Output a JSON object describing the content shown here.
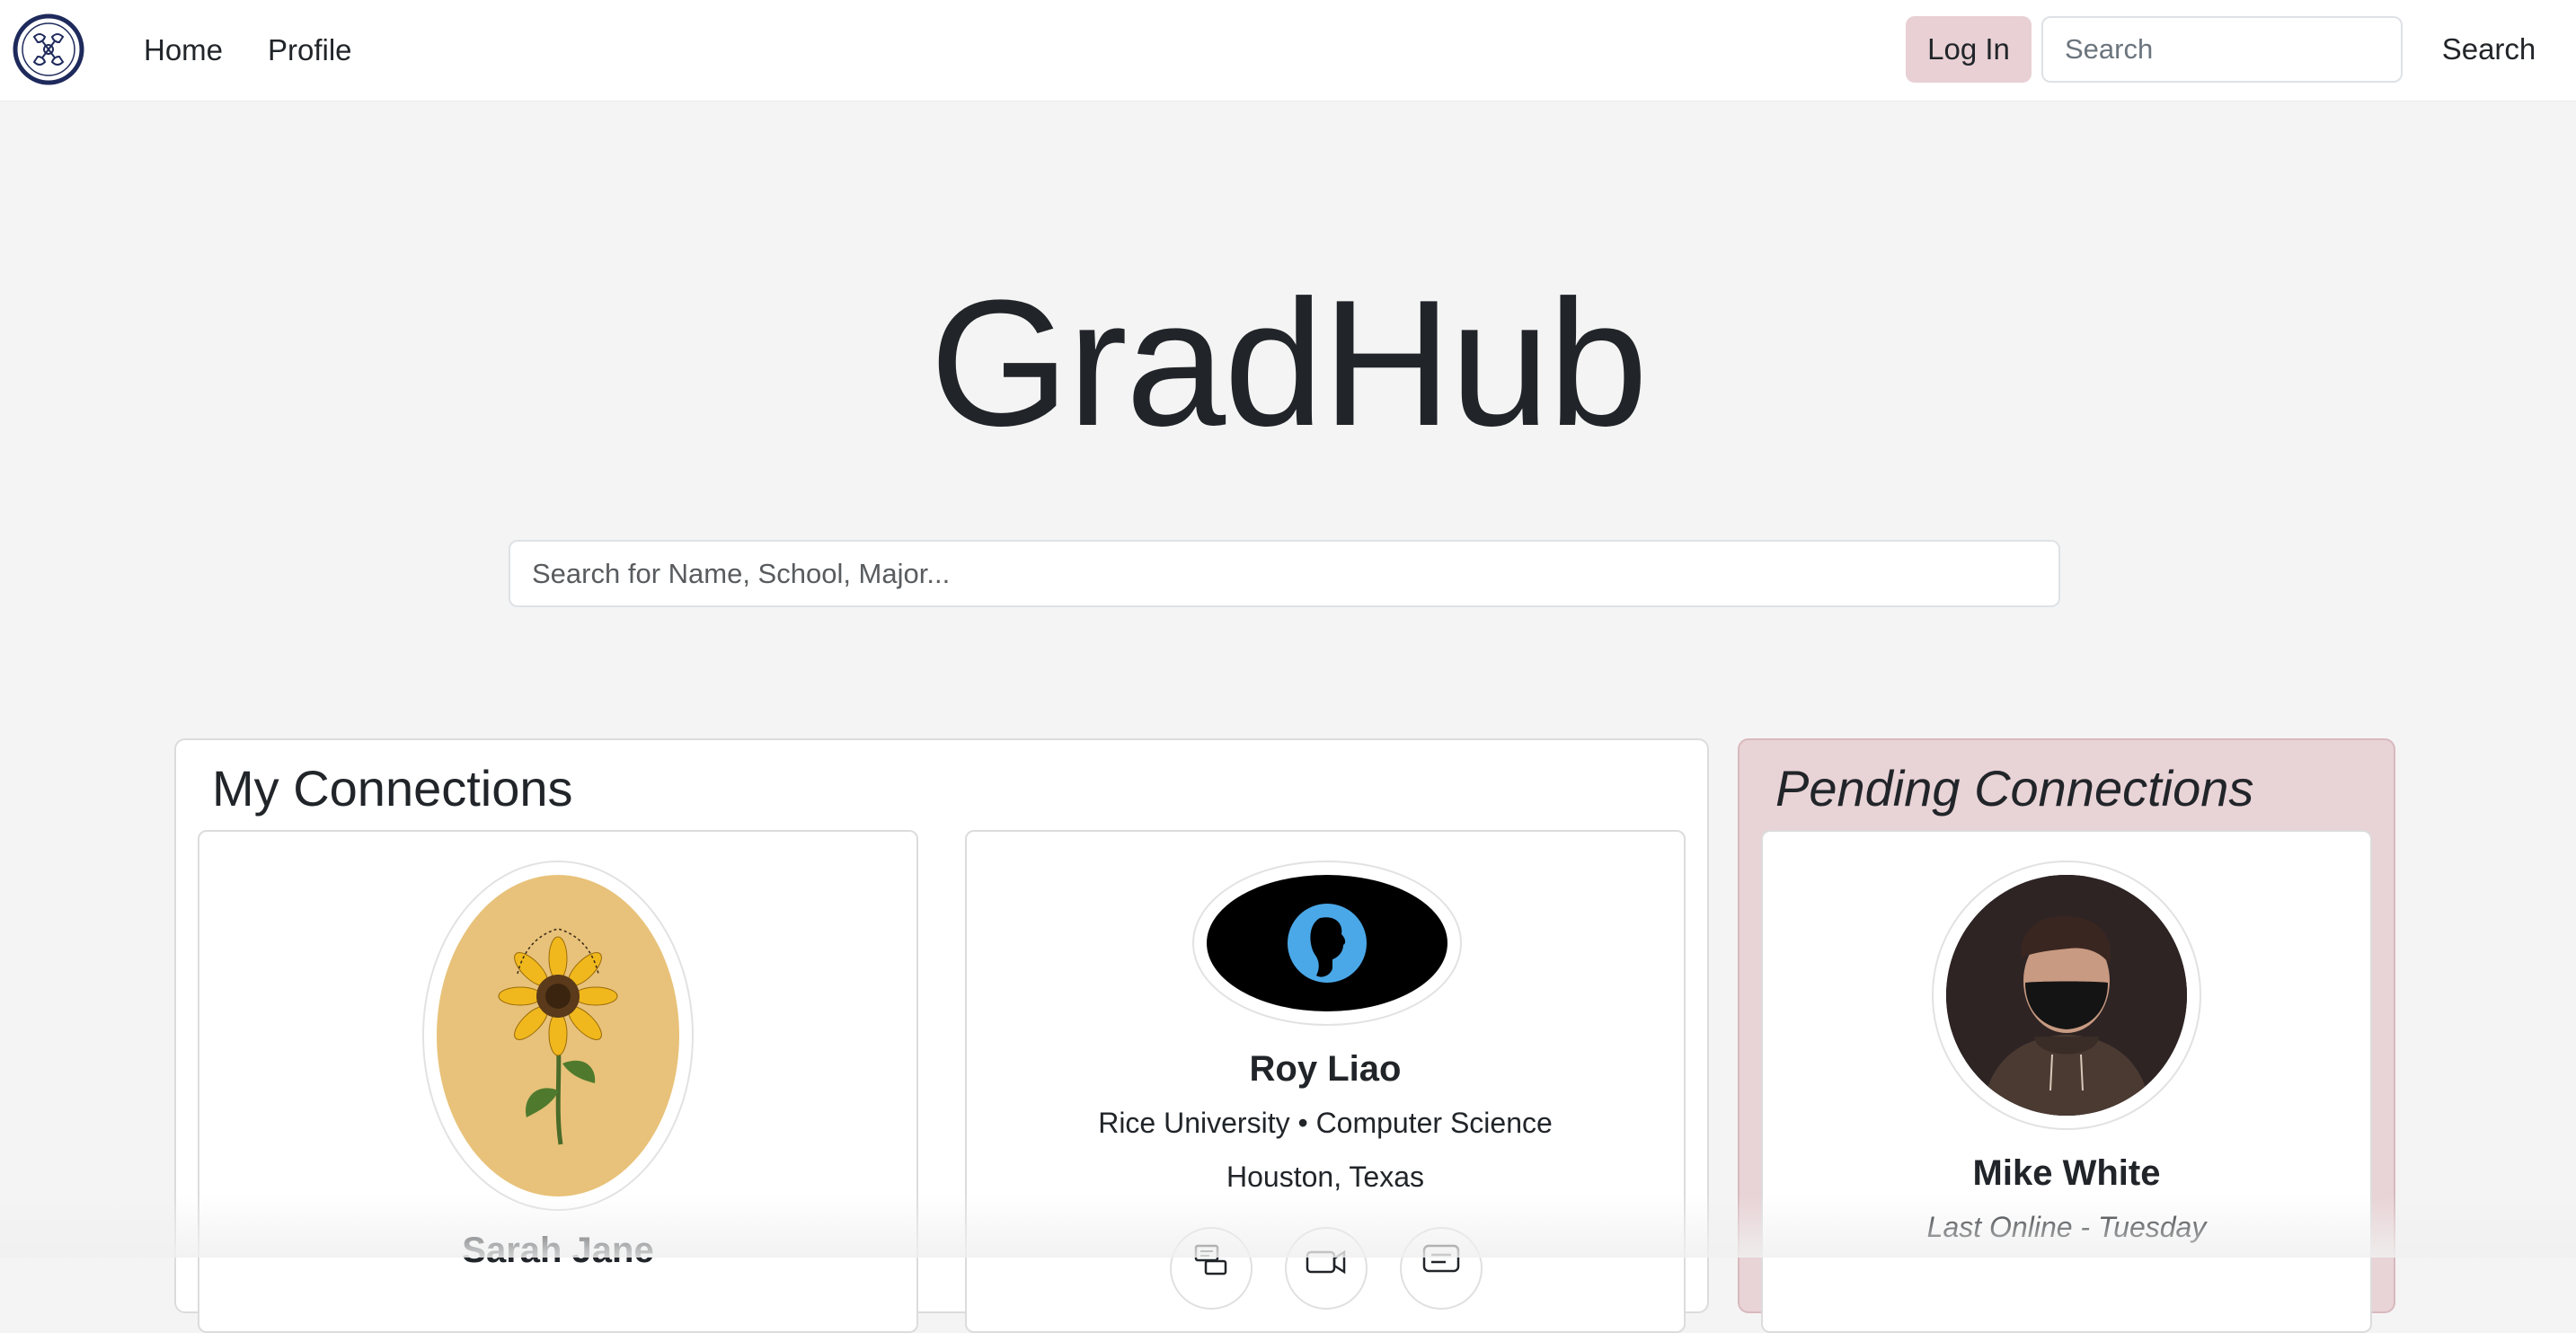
{
  "navbar": {
    "logo_icon": "gradhub-logo-icon",
    "links": [
      {
        "label": "Home"
      },
      {
        "label": "Profile"
      }
    ],
    "login_label": "Log In",
    "search_placeholder": "Search",
    "search_button_label": "Search"
  },
  "hero": {
    "title": "GradHub",
    "search_placeholder": "Search for Name, School, Major..."
  },
  "my_connections": {
    "title": "My Connections",
    "cards": [
      {
        "name": "Sarah Jane",
        "avatar_icon": "sunflower-avatar-icon"
      },
      {
        "name": "Roy Liao",
        "school_major": "Rice University • Computer Science",
        "location": "Houston, Texas",
        "avatar_icon": "default-person-avatar-icon",
        "actions": [
          "message-icon",
          "video-call-icon",
          "chat-icon"
        ]
      }
    ]
  },
  "pending_connections": {
    "title": "Pending Connections",
    "cards": [
      {
        "name": "Mike White",
        "status": "Last Online - Tuesday",
        "avatar_icon": "masked-person-avatar-icon"
      }
    ]
  },
  "colors": {
    "page_bg": "#f4f4f4",
    "accent_pink": "#e8d0d4",
    "pending_bg": "#e8d3d6",
    "text": "#212529",
    "logo_navy": "#1f2a5c",
    "sunflower_bg": "#e8c27a",
    "avatar_blue": "#4aa8e8"
  }
}
